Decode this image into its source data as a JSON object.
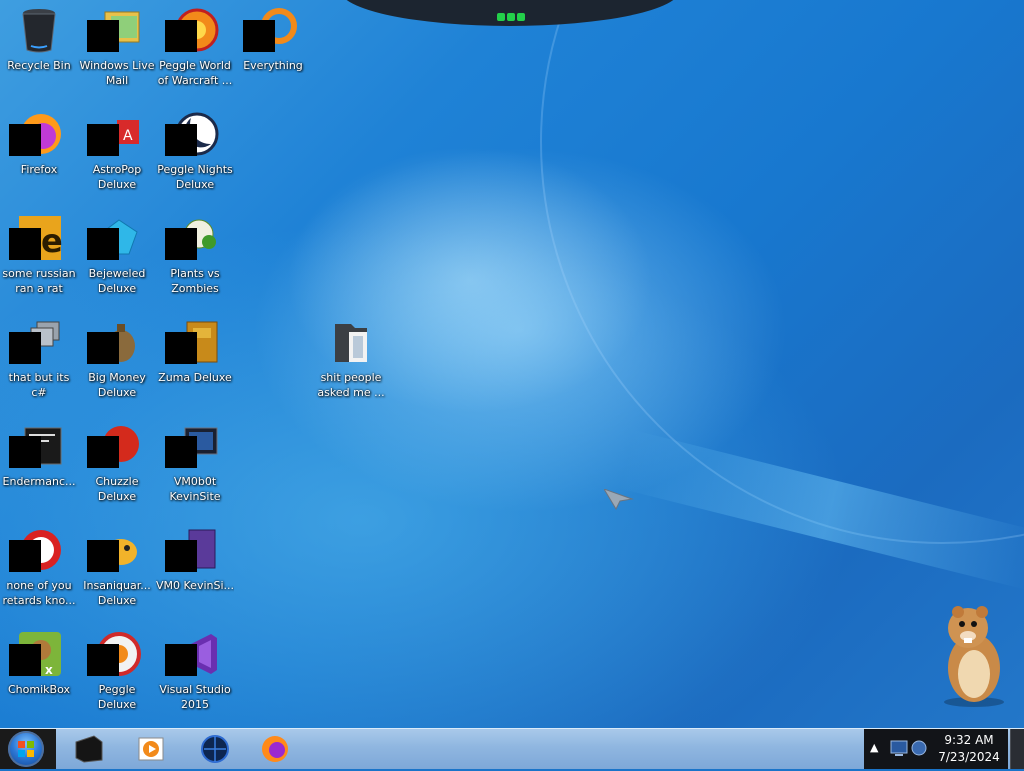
{
  "desktop": {
    "icons": [
      {
        "id": "recycle-bin",
        "label": "Recycle Bin"
      },
      {
        "id": "windows-live-mail",
        "label": "Windows Live Mail"
      },
      {
        "id": "peggle-world-of-warcraft",
        "label": "Peggle World of Warcraft ..."
      },
      {
        "id": "everything",
        "label": "Everything"
      },
      {
        "id": "firefox",
        "label": "Firefox"
      },
      {
        "id": "astropop-deluxe",
        "label": "AstroPop Deluxe"
      },
      {
        "id": "peggle-nights-deluxe",
        "label": "Peggle Nights Deluxe"
      },
      {
        "id": "some-russian-ran-a-rat",
        "label": "some russian ran a rat"
      },
      {
        "id": "bejeweled-deluxe",
        "label": "Bejeweled Deluxe"
      },
      {
        "id": "plants-vs-zombies",
        "label": "Plants vs Zombies"
      },
      {
        "id": "that-but-its-csharp",
        "label": "that but its c#"
      },
      {
        "id": "big-money-deluxe",
        "label": "Big Money Deluxe"
      },
      {
        "id": "zuma-deluxe",
        "label": "Zuma Deluxe"
      },
      {
        "id": "shit-people-asked-me",
        "label": "shit people asked me ..."
      },
      {
        "id": "endermanch",
        "label": "Endermanc..."
      },
      {
        "id": "chuzzle-deluxe",
        "label": "Chuzzle Deluxe"
      },
      {
        "id": "vm0b0t-kevinsite",
        "label": "VM0b0t KevinSite"
      },
      {
        "id": "none-of-you",
        "label": "none of you retards kno..."
      },
      {
        "id": "insaniquarium-deluxe",
        "label": "Insaniquar... Deluxe"
      },
      {
        "id": "vm0-kevinsite",
        "label": "VM0 KevinSi..."
      },
      {
        "id": "chomikbox",
        "label": "ChomikBox"
      },
      {
        "id": "peggle-deluxe",
        "label": "Peggle Deluxe"
      },
      {
        "id": "visual-studio-2015",
        "label": "Visual Studio 2015"
      }
    ]
  },
  "taskbar": {
    "start_button": "start-orb-icon",
    "pinned": [
      "terminal-icon",
      "media-player-icon",
      "globe-app-icon",
      "firefox-icon"
    ],
    "tray": {
      "expand_glyph": "▲",
      "network_icon": "network-icon"
    },
    "clock": {
      "time": "9:32 AM",
      "date": "7/23/2024"
    }
  }
}
